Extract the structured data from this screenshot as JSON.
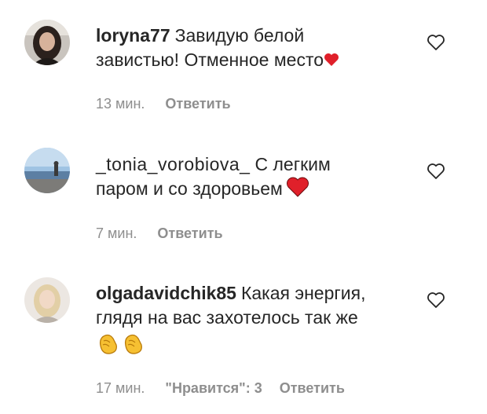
{
  "comments": [
    {
      "username": "loryna77",
      "text_line1": "Завидую белой",
      "text_line2": "завистью! Отменное место",
      "time": "13 мин.",
      "reply_label": "Ответить",
      "emoji": "red-heart"
    },
    {
      "username": "_tonia_vorobiova_",
      "text_line1": "С легким",
      "text_line2": "паром и со здоровьем",
      "time": "7 мин.",
      "reply_label": "Ответить",
      "emoji": "red-heart"
    },
    {
      "username": "olgadavidchik85",
      "text_line1": "Какая энергия,",
      "text_line2": "глядя на вас захотелось так же",
      "time": "17 мин.",
      "likes": "\"Нравится\": 3",
      "reply_label": "Ответить",
      "emoji": "clapping-hands"
    }
  ],
  "colors": {
    "text": "#262626",
    "meta": "#8e8e8e",
    "heart_emoji": "#e0202a"
  }
}
